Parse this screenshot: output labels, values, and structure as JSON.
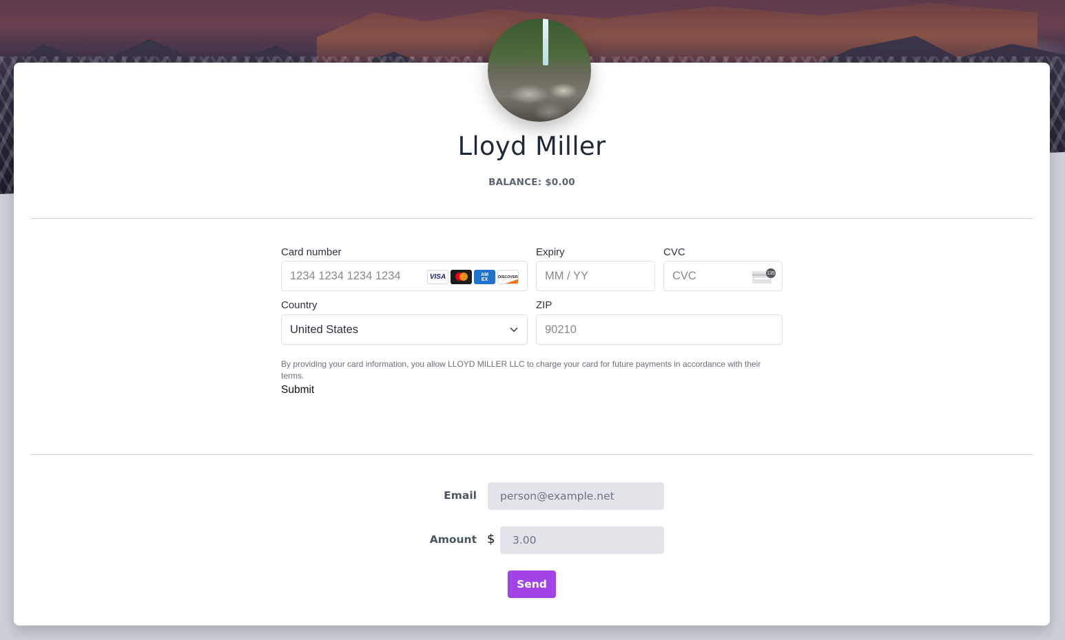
{
  "profile": {
    "name": "Lloyd Miller",
    "balance_label": "BALANCE: $0.00",
    "avatar_alt": "waterfall-photo"
  },
  "payment_form": {
    "card_number": {
      "label": "Card number",
      "placeholder": "1234 1234 1234 1234",
      "brands": [
        "VISA",
        "Mastercard",
        "AMEX",
        "DISCOVER"
      ]
    },
    "expiry": {
      "label": "Expiry",
      "placeholder": "MM / YY"
    },
    "cvc": {
      "label": "CVC",
      "placeholder": "CVC",
      "icon_badge": "135"
    },
    "country": {
      "label": "Country",
      "value": "United States"
    },
    "zip": {
      "label": "ZIP",
      "placeholder": "90210"
    },
    "terms": "By providing your card information, you allow LLOYD MILLER LLC to charge your card for future payments in accordance with their terms.",
    "submit_label": "Submit"
  },
  "send_form": {
    "email": {
      "label": "Email",
      "placeholder": "person@example.net"
    },
    "amount": {
      "label": "Amount",
      "currency": "$",
      "placeholder": "3.00"
    },
    "send_label": "Send"
  },
  "colors": {
    "accent": "#a243e8",
    "page_bg": "#cbd0d8",
    "input_bg": "#e2e4e9"
  }
}
